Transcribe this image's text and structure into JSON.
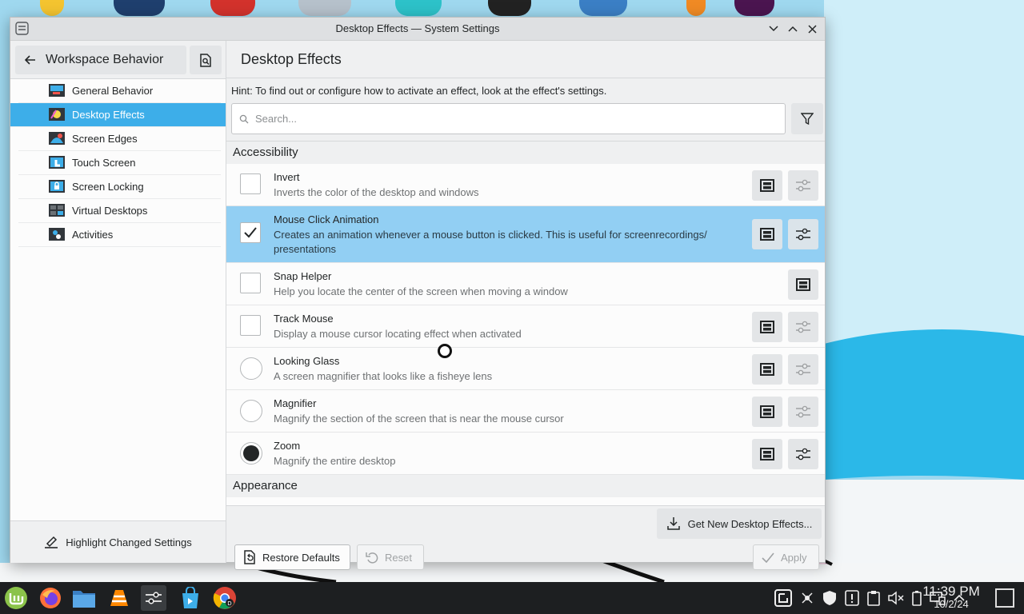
{
  "window": {
    "title": "Desktop Effects — System Settings"
  },
  "sidebar": {
    "back_label": "Workspace Behavior",
    "items": [
      {
        "label": "General Behavior"
      },
      {
        "label": "Desktop Effects"
      },
      {
        "label": "Screen Edges"
      },
      {
        "label": "Touch Screen"
      },
      {
        "label": "Screen Locking"
      },
      {
        "label": "Virtual Desktops"
      },
      {
        "label": "Activities"
      }
    ],
    "footer_label": "Highlight Changed Settings"
  },
  "main": {
    "title": "Desktop Effects",
    "hint": "Hint: To find out or configure how to activate an effect, look at the effect's settings.",
    "search_placeholder": "Search...",
    "sections": {
      "accessibility": "Accessibility",
      "appearance": "Appearance"
    },
    "effects": [
      {
        "name": "Invert",
        "desc": "Inverts the color of the desktop and windows",
        "control": "checkbox",
        "checked": false
      },
      {
        "name": "Mouse Click Animation",
        "desc": "Creates an animation whenever a mouse button is clicked. This is useful for screenrecordings/ presentations",
        "control": "checkbox",
        "checked": true
      },
      {
        "name": "Snap Helper",
        "desc": "Help you locate the center of the screen when moving a window",
        "control": "checkbox",
        "checked": false
      },
      {
        "name": "Track Mouse",
        "desc": "Display a mouse cursor locating effect when activated",
        "control": "checkbox",
        "checked": false
      },
      {
        "name": "Looking Glass",
        "desc": "A screen magnifier that looks like a fisheye lens",
        "control": "radio",
        "checked": false
      },
      {
        "name": "Magnifier",
        "desc": "Magnify the section of the screen that is near the mouse cursor",
        "control": "radio",
        "checked": false
      },
      {
        "name": "Zoom",
        "desc": "Magnify the entire desktop",
        "control": "radio",
        "checked": true
      }
    ],
    "get_new_label": "Get New Desktop Effects...",
    "restore_defaults_label": "Restore Defaults",
    "reset_label": "Reset",
    "apply_label": "Apply"
  },
  "taskbar": {
    "time": "11:39 PM",
    "date": "10/2/24"
  },
  "colors": {
    "accent": "#3daee9",
    "selection": "#92cff3",
    "taskbar": "#1d1f21"
  }
}
